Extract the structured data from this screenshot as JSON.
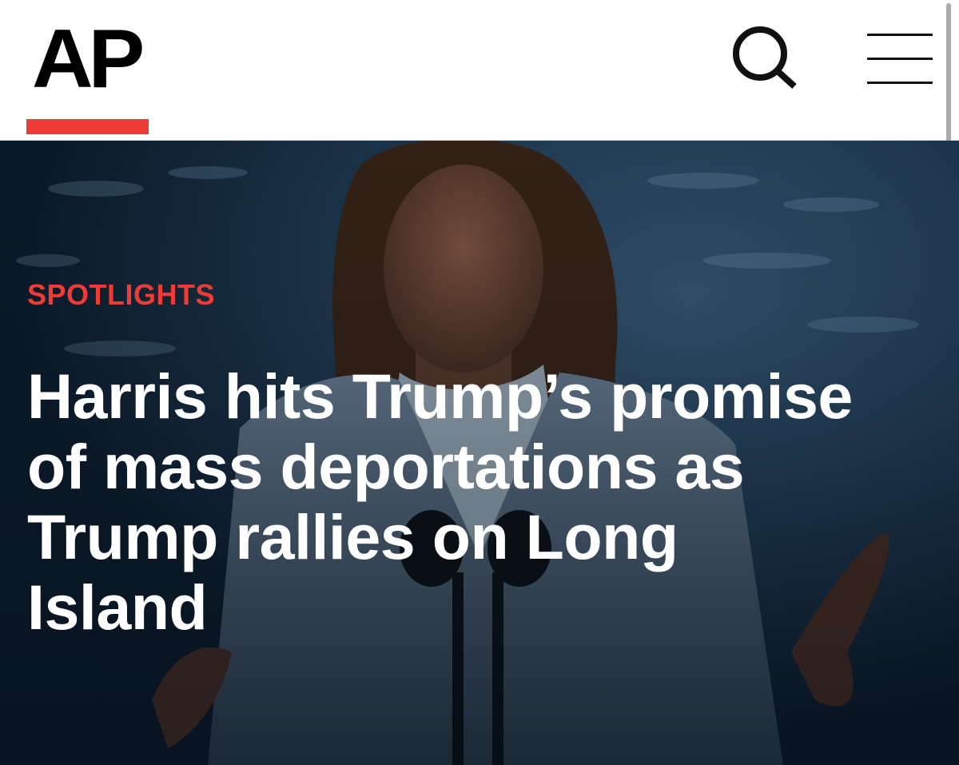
{
  "header": {
    "logo_text": "AP",
    "accent_color": "#ef3b36",
    "search_icon": "search-icon",
    "menu_icon": "hamburger-menu-icon"
  },
  "hero": {
    "kicker": "SPOTLIGHTS",
    "headline": "Harris hits Trump’s promise of mass deportations as Trump rallies on Long Island"
  }
}
